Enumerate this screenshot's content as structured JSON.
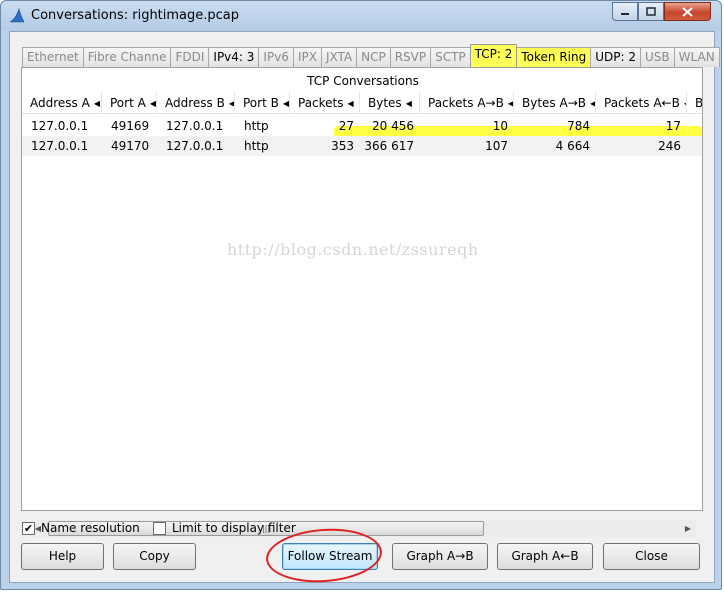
{
  "window": {
    "title": "Conversations: rightimage.pcap"
  },
  "tabs": [
    {
      "label": "Ethernet",
      "style": "dim"
    },
    {
      "label": "Fibre Channe",
      "style": "dim"
    },
    {
      "label": "FDDI",
      "style": "dim"
    },
    {
      "label": "IPv4: 3",
      "style": "strong"
    },
    {
      "label": "IPv6",
      "style": "dim"
    },
    {
      "label": "IPX",
      "style": "dim"
    },
    {
      "label": "JXTA",
      "style": "dim"
    },
    {
      "label": "NCP",
      "style": "dim"
    },
    {
      "label": "RSVP",
      "style": "dim"
    },
    {
      "label": "SCTP",
      "style": "dim"
    },
    {
      "label": "TCP: 2",
      "style": "active"
    },
    {
      "label": "Token Ring",
      "style": "hl"
    },
    {
      "label": "UDP: 2",
      "style": "strong"
    },
    {
      "label": "USB",
      "style": "dim"
    },
    {
      "label": "WLAN",
      "style": "dim"
    }
  ],
  "table": {
    "title": "TCP Conversations",
    "columns": [
      "Address A",
      "Port A",
      "Address B",
      "Port B",
      "Packets",
      "Bytes",
      "Packets A→B",
      "Bytes A→B",
      "Packets A←B",
      "B"
    ],
    "rows": [
      [
        "127.0.0.1",
        "49169",
        "127.0.0.1",
        "http",
        "27",
        "20 456",
        "10",
        "784",
        "17"
      ],
      [
        "127.0.0.1",
        "49170",
        "127.0.0.1",
        "http",
        "353",
        "366 617",
        "107",
        "4 664",
        "246"
      ]
    ],
    "highlight_color": "#ffff44"
  },
  "watermark": "http://blog.csdn.net/zssureqh",
  "options": {
    "name_resolution": {
      "label": "Name resolution",
      "checked": true
    },
    "limit_filter": {
      "label": "Limit to display filter",
      "checked": false
    }
  },
  "buttons": {
    "help": "Help",
    "copy": "Copy",
    "follow_stream": "Follow Stream",
    "graph_ab": "Graph A→B",
    "graph_ba": "Graph A←B",
    "close": "Close"
  },
  "icons": {
    "app": "shark-fin-icon",
    "minimize": "minimize-icon",
    "maximize": "maximize-icon",
    "close": "close-icon"
  }
}
